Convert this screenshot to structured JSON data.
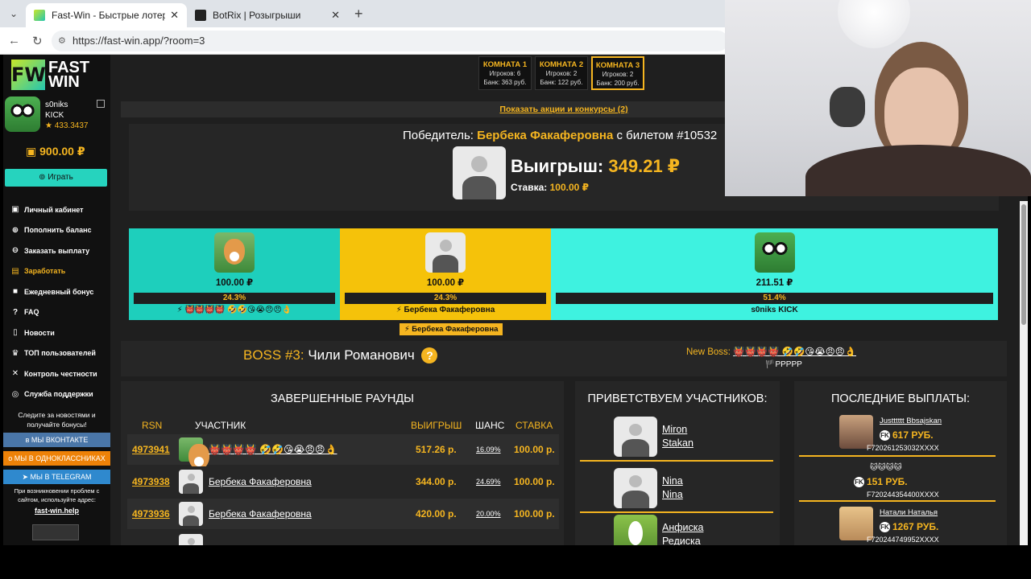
{
  "browser": {
    "tabs": [
      {
        "title": "Fast-Win - Быстрые лотереи! Ком",
        "active": true
      },
      {
        "title": "BotRix | Розыгрыши",
        "active": false
      }
    ],
    "url": "https://fast-win.app/?room=3"
  },
  "site": {
    "logo_text_1": "FAST",
    "logo_text_2": "WIN",
    "logo_mark": "FW",
    "user": {
      "name": "s0niks",
      "name2": "KICK",
      "rating": "★ 433.3437"
    },
    "balance": "900.00 ₽",
    "play_label": "Играть",
    "menu": [
      {
        "label": "Личный кабинет",
        "icon": "wallet-icon",
        "glyph": "▣"
      },
      {
        "label": "Пополнить баланс",
        "icon": "plus-circle-icon",
        "glyph": "⊕"
      },
      {
        "label": "Заказать выплату",
        "icon": "arrow-down-circle-icon",
        "glyph": "⊖"
      },
      {
        "label": "Заработать",
        "icon": "money-icon",
        "glyph": "▤"
      },
      {
        "label": "Ежедневный бонус",
        "icon": "gift-icon",
        "glyph": "■"
      },
      {
        "label": "FAQ",
        "icon": "question-icon",
        "glyph": "?"
      },
      {
        "label": "Новости",
        "icon": "bookmark-icon",
        "glyph": "▯"
      },
      {
        "label": "ТОП пользователей",
        "icon": "trophy-icon",
        "glyph": "♛"
      },
      {
        "label": "Контроль честности",
        "icon": "shuffle-icon",
        "glyph": "✕"
      },
      {
        "label": "Служба поддержки",
        "icon": "support-icon",
        "glyph": "◎"
      }
    ],
    "follow_text": "Следите за новостями и получайте бонусы!",
    "social": [
      {
        "label": "МЫ ВКОНТАКТЕ",
        "color": "#4a76a8"
      },
      {
        "label": "МЫ В ОДНОКЛАССНИКАХ",
        "color": "#ee8208"
      },
      {
        "label": "МЫ В TELEGRAM",
        "color": "#2f89ce"
      }
    ],
    "trouble_text": "При возникновении проблем с сайтом, используйте адрес:",
    "help_link": "fast-win.help"
  },
  "rooms": [
    {
      "name": "КОМНАТА 1",
      "players": "Игроков: 6",
      "bank": "Банк: 363 руб.",
      "active": false
    },
    {
      "name": "КОМНАТА 2",
      "players": "Игроков: 2",
      "bank": "Банк: 122 руб.",
      "active": false
    },
    {
      "name": "КОМНАТА 3",
      "players": "Игроков: 2",
      "bank": "Банк: 200 руб.",
      "active": true
    }
  ],
  "promo": "Показать акции и конкурсы (2)",
  "winner": {
    "prefix": "Победитель:",
    "name": "Бербека Факаферовна",
    "ticket": "с билетом #10532",
    "win_label": "Выигрыш:",
    "win_amount": "349.21 ₽",
    "bet_label": "Ставка:",
    "bet_amount": "100.00 ₽"
  },
  "participants": [
    {
      "bet": "100.00 ₽",
      "pct": "24.3%",
      "name": "⚡ 👹👹👹👹 🤣🤣😘😭😠😠👌",
      "color": "#1ecfbc",
      "share": 0.243
    },
    {
      "bet": "100.00 ₽",
      "pct": "24.3%",
      "name": "⚡ Бербека Факаферовна",
      "color": "#f5c20a",
      "share": 0.243
    },
    {
      "bet": "211.51 ₽",
      "pct": "51.4%",
      "name": "s0niks KICK",
      "color": "#3ef2e0",
      "share": 0.514
    }
  ],
  "tooltip": "⚡ Бербека Факаферовна",
  "boss": {
    "label": "BOSS #3:",
    "name": "Чили Романович",
    "new_boss_label": "New Boss:",
    "new_boss_name": "👹👹👹👹 🤣🤣😘😭😠😠👌",
    "new_boss_sub": "🏴PPPPP"
  },
  "rounds": {
    "title": "ЗАВЕРШЕННЫЕ РАУНДЫ",
    "headers": {
      "rsn": "RSN",
      "user": "УЧАСТНИК",
      "win": "ВЫИГРЫШ",
      "chance": "ШАНС",
      "bet": "СТАВКА"
    },
    "rows": [
      {
        "rsn": "4973941",
        "user": "👹👹👹👹 🤣🤣😘😭😠😠👌",
        "win": "517.26 р.",
        "chance": "16.09%",
        "bet": "100.00 р."
      },
      {
        "rsn": "4973938",
        "user": "Бербека Факаферовна",
        "win": "344.00 р.",
        "chance": "24.69%",
        "bet": "100.00 р."
      },
      {
        "rsn": "4973936",
        "user": "Бербека Факаферовна",
        "win": "420.00 р.",
        "chance": "20.00%",
        "bet": "100.00 р."
      }
    ]
  },
  "welcome": {
    "title": "ПРИВЕТСТВУЕМ УЧАСТНИКОВ:",
    "rows": [
      {
        "first": "Miron",
        "last": "Stakan"
      },
      {
        "first": "Nina",
        "last": "Nina"
      },
      {
        "first": "Анфиска",
        "last": "Редиска"
      }
    ]
  },
  "payouts": {
    "title": "ПОСЛЕДНИЕ ВЫПЛАТЫ:",
    "rows": [
      {
        "name": "Justttttt Bbsajskan",
        "amount": "617 РУБ.",
        "id": "F72026125303​2XXXX"
      },
      {
        "name": "🐱🐱🐱🐱",
        "amount": "151 РУБ.",
        "id": "F72024435440​0XXXX"
      },
      {
        "name": "Натали Наталья",
        "amount": "1267 РУБ.",
        "id": "F72024474995​2XXXX"
      }
    ]
  }
}
